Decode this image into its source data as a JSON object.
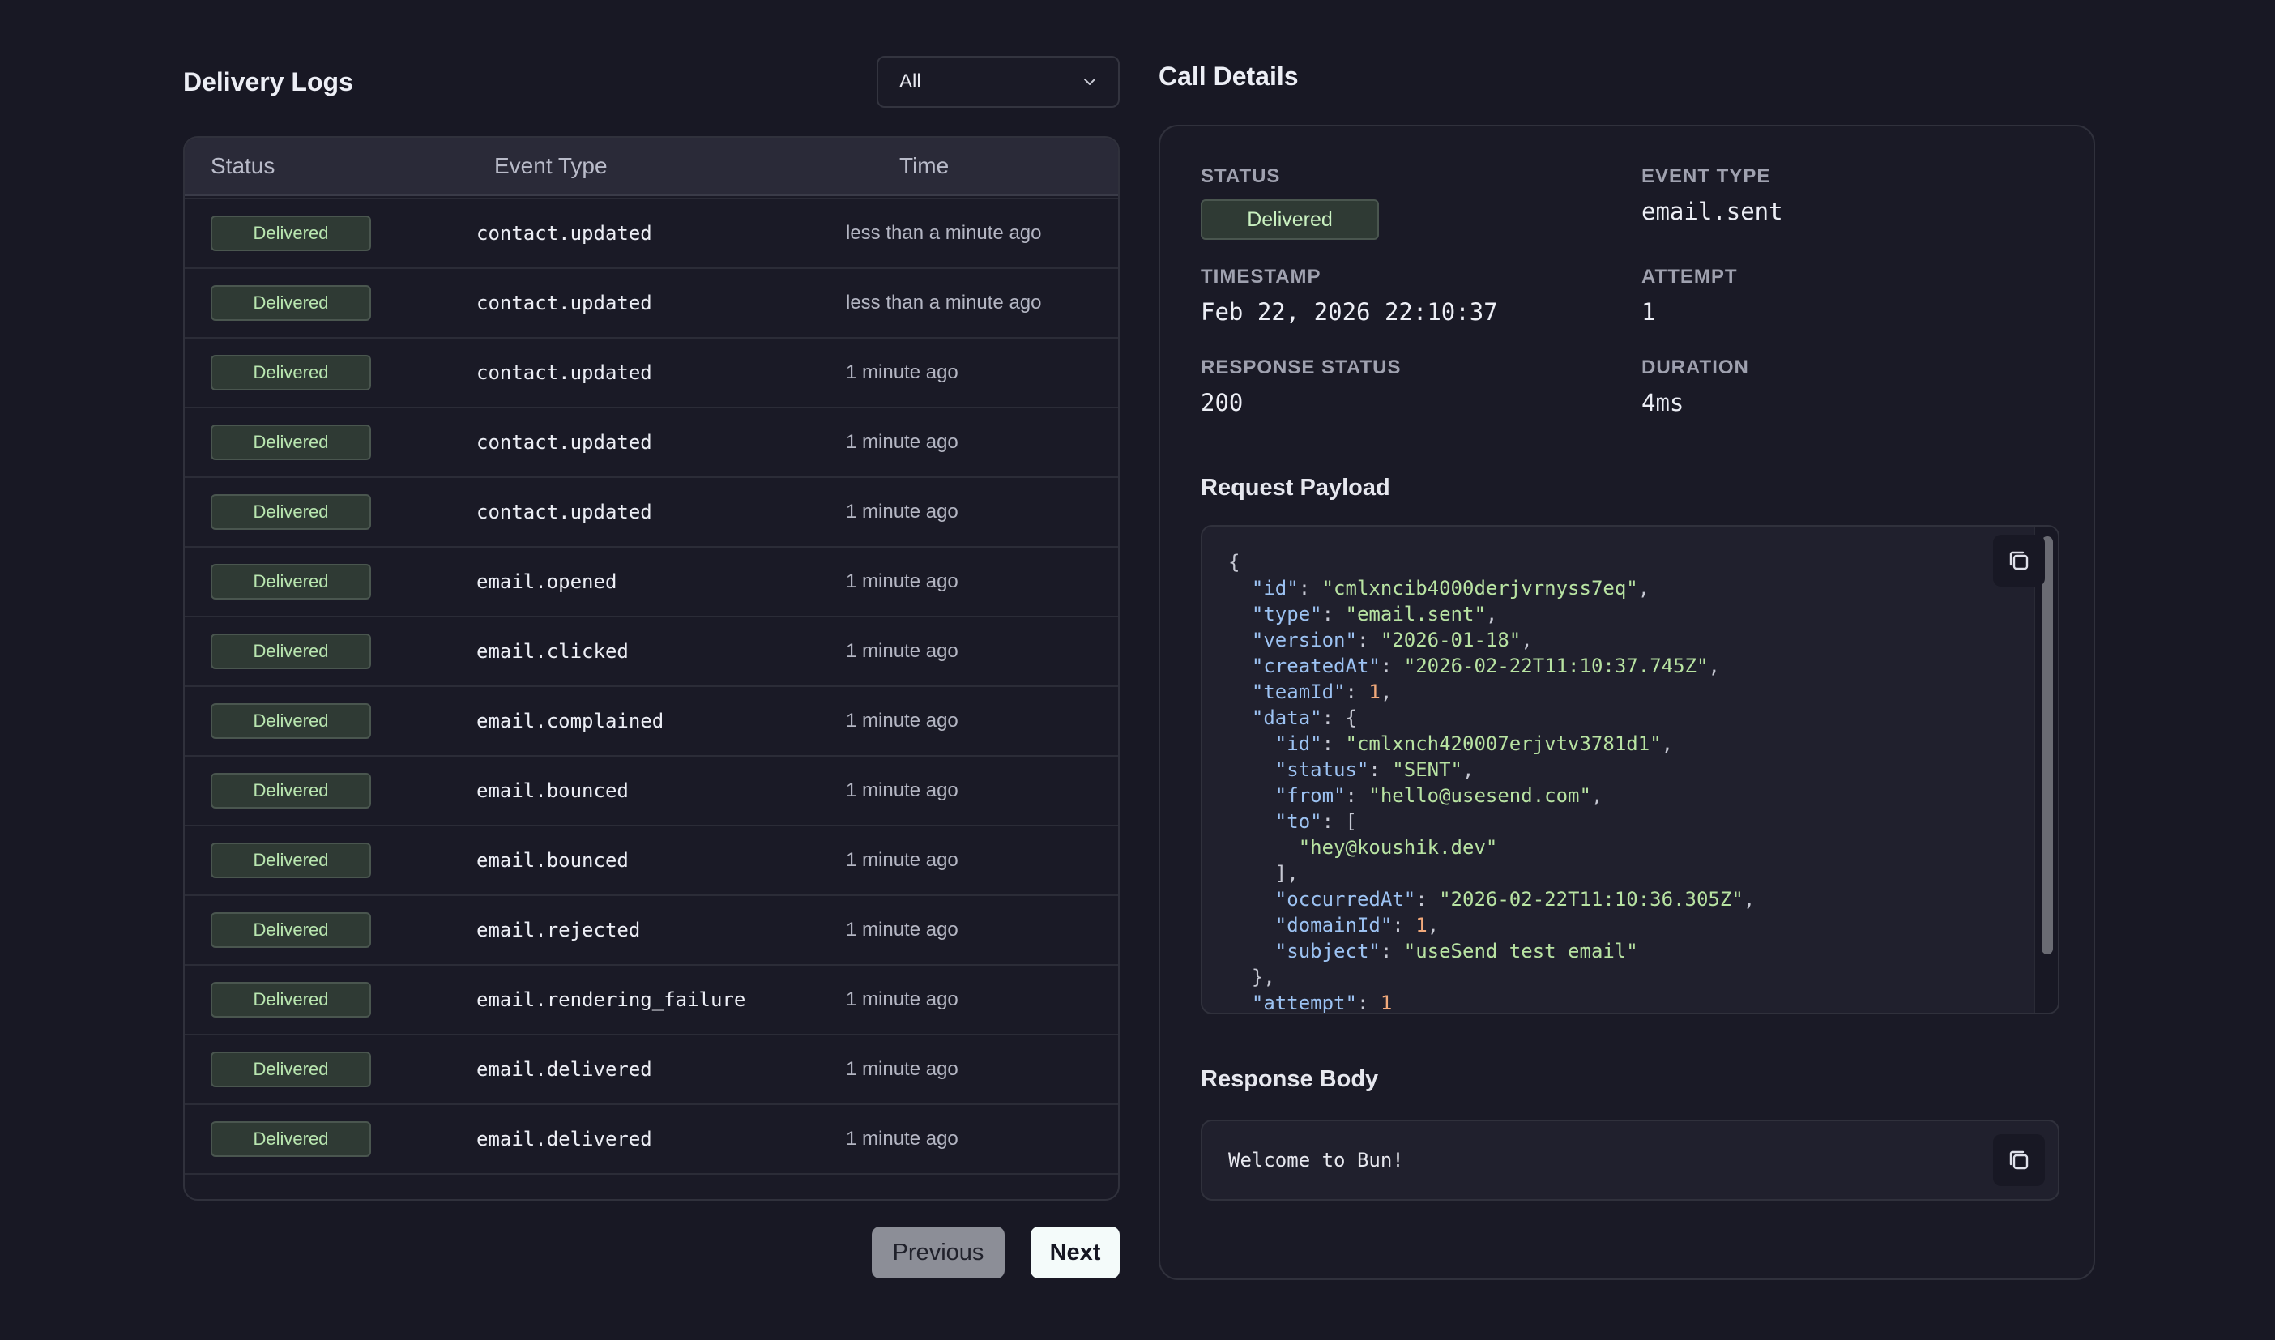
{
  "logs": {
    "title": "Delivery Logs",
    "filter": {
      "value": "All"
    },
    "columns": {
      "status": "Status",
      "event": "Event Type",
      "time": "Time"
    },
    "partial_row": {
      "status": "Delivered",
      "event": "contact.updated",
      "time": "less than a minute ago"
    },
    "rows": [
      {
        "status": "Delivered",
        "event": "contact.updated",
        "time": "less than a minute ago"
      },
      {
        "status": "Delivered",
        "event": "contact.updated",
        "time": "less than a minute ago"
      },
      {
        "status": "Delivered",
        "event": "contact.updated",
        "time": "1 minute ago"
      },
      {
        "status": "Delivered",
        "event": "contact.updated",
        "time": "1 minute ago"
      },
      {
        "status": "Delivered",
        "event": "contact.updated",
        "time": "1 minute ago"
      },
      {
        "status": "Delivered",
        "event": "email.opened",
        "time": "1 minute ago"
      },
      {
        "status": "Delivered",
        "event": "email.clicked",
        "time": "1 minute ago"
      },
      {
        "status": "Delivered",
        "event": "email.complained",
        "time": "1 minute ago"
      },
      {
        "status": "Delivered",
        "event": "email.bounced",
        "time": "1 minute ago"
      },
      {
        "status": "Delivered",
        "event": "email.bounced",
        "time": "1 minute ago"
      },
      {
        "status": "Delivered",
        "event": "email.rejected",
        "time": "1 minute ago"
      },
      {
        "status": "Delivered",
        "event": "email.rendering_failure",
        "time": "1 minute ago"
      },
      {
        "status": "Delivered",
        "event": "email.delivered",
        "time": "1 minute ago"
      },
      {
        "status": "Delivered",
        "event": "email.delivered",
        "time": "1 minute ago"
      }
    ],
    "pagination": {
      "prev": "Previous",
      "next": "Next"
    }
  },
  "details": {
    "title": "Call Details",
    "status": {
      "label": "STATUS",
      "value": "Delivered"
    },
    "event_type": {
      "label": "EVENT TYPE",
      "value": "email.sent"
    },
    "timestamp": {
      "label": "TIMESTAMP",
      "value": "Feb 22, 2026 22:10:37"
    },
    "attempt": {
      "label": "ATTEMPT",
      "value": "1"
    },
    "response_status": {
      "label": "RESPONSE STATUS",
      "value": "200"
    },
    "duration": {
      "label": "DURATION",
      "value": "4ms"
    },
    "request_payload_title": "Request Payload",
    "response_body_title": "Response Body",
    "response_body": "Welcome to Bun!",
    "payload_lines": [
      [
        {
          "t": "p",
          "v": "{"
        }
      ],
      [
        {
          "t": "p",
          "v": "  "
        },
        {
          "t": "k",
          "v": "\"id\""
        },
        {
          "t": "p",
          "v": ": "
        },
        {
          "t": "s",
          "v": "\"cmlxncib4000derjvrnyss7eq\""
        },
        {
          "t": "p",
          "v": ","
        }
      ],
      [
        {
          "t": "p",
          "v": "  "
        },
        {
          "t": "k",
          "v": "\"type\""
        },
        {
          "t": "p",
          "v": ": "
        },
        {
          "t": "s",
          "v": "\"email.sent\""
        },
        {
          "t": "p",
          "v": ","
        }
      ],
      [
        {
          "t": "p",
          "v": "  "
        },
        {
          "t": "k",
          "v": "\"version\""
        },
        {
          "t": "p",
          "v": ": "
        },
        {
          "t": "s",
          "v": "\"2026-01-18\""
        },
        {
          "t": "p",
          "v": ","
        }
      ],
      [
        {
          "t": "p",
          "v": "  "
        },
        {
          "t": "k",
          "v": "\"createdAt\""
        },
        {
          "t": "p",
          "v": ": "
        },
        {
          "t": "s",
          "v": "\"2026-02-22T11:10:37.745Z\""
        },
        {
          "t": "p",
          "v": ","
        }
      ],
      [
        {
          "t": "p",
          "v": "  "
        },
        {
          "t": "k",
          "v": "\"teamId\""
        },
        {
          "t": "p",
          "v": ": "
        },
        {
          "t": "n",
          "v": "1"
        },
        {
          "t": "p",
          "v": ","
        }
      ],
      [
        {
          "t": "p",
          "v": "  "
        },
        {
          "t": "k",
          "v": "\"data\""
        },
        {
          "t": "p",
          "v": ": {"
        }
      ],
      [
        {
          "t": "p",
          "v": "    "
        },
        {
          "t": "k",
          "v": "\"id\""
        },
        {
          "t": "p",
          "v": ": "
        },
        {
          "t": "s",
          "v": "\"cmlxnch420007erjvtv3781d1\""
        },
        {
          "t": "p",
          "v": ","
        }
      ],
      [
        {
          "t": "p",
          "v": "    "
        },
        {
          "t": "k",
          "v": "\"status\""
        },
        {
          "t": "p",
          "v": ": "
        },
        {
          "t": "s",
          "v": "\"SENT\""
        },
        {
          "t": "p",
          "v": ","
        }
      ],
      [
        {
          "t": "p",
          "v": "    "
        },
        {
          "t": "k",
          "v": "\"from\""
        },
        {
          "t": "p",
          "v": ": "
        },
        {
          "t": "s",
          "v": "\"hello@usesend.com\""
        },
        {
          "t": "p",
          "v": ","
        }
      ],
      [
        {
          "t": "p",
          "v": "    "
        },
        {
          "t": "k",
          "v": "\"to\""
        },
        {
          "t": "p",
          "v": ": ["
        }
      ],
      [
        {
          "t": "p",
          "v": "      "
        },
        {
          "t": "s",
          "v": "\"hey@koushik.dev\""
        }
      ],
      [
        {
          "t": "p",
          "v": "    ],"
        }
      ],
      [
        {
          "t": "p",
          "v": "    "
        },
        {
          "t": "k",
          "v": "\"occurredAt\""
        },
        {
          "t": "p",
          "v": ": "
        },
        {
          "t": "s",
          "v": "\"2026-02-22T11:10:36.305Z\""
        },
        {
          "t": "p",
          "v": ","
        }
      ],
      [
        {
          "t": "p",
          "v": "    "
        },
        {
          "t": "k",
          "v": "\"domainId\""
        },
        {
          "t": "p",
          "v": ": "
        },
        {
          "t": "n",
          "v": "1"
        },
        {
          "t": "p",
          "v": ","
        }
      ],
      [
        {
          "t": "p",
          "v": "    "
        },
        {
          "t": "k",
          "v": "\"subject\""
        },
        {
          "t": "p",
          "v": ": "
        },
        {
          "t": "s",
          "v": "\"useSend test email\""
        }
      ],
      [
        {
          "t": "p",
          "v": "  },"
        }
      ],
      [
        {
          "t": "p",
          "v": "  "
        },
        {
          "t": "k",
          "v": "\"attempt\""
        },
        {
          "t": "p",
          "v": ": "
        },
        {
          "t": "n",
          "v": "1"
        }
      ]
    ]
  }
}
